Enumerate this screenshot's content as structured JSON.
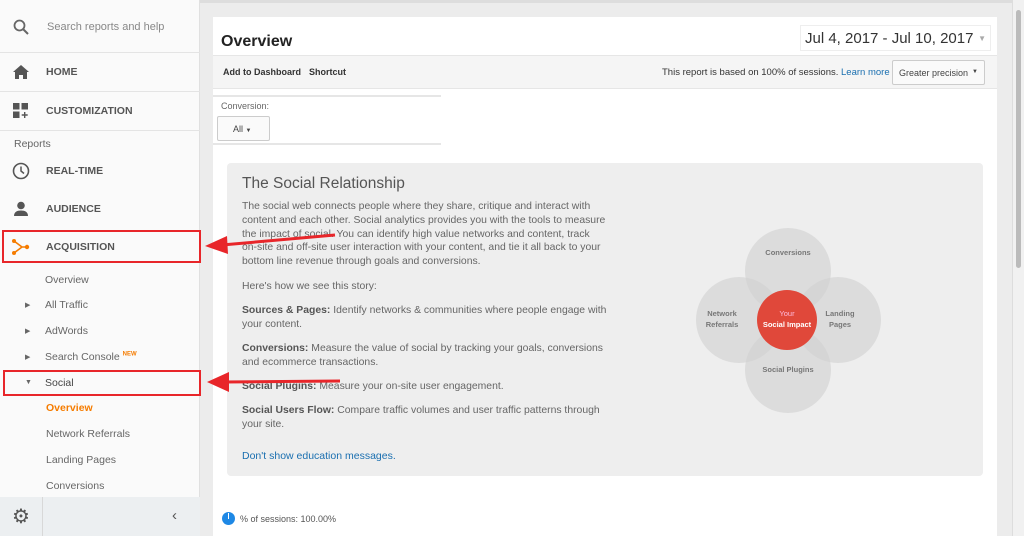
{
  "sidebar": {
    "search_placeholder": "Search reports and help",
    "home": "HOME",
    "customization": "CUSTOMIZATION",
    "reports_label": "Reports",
    "realtime": "REAL-TIME",
    "audience": "AUDIENCE",
    "acquisition": "ACQUISITION",
    "acq_items": {
      "overview": "Overview",
      "all_traffic": "All Traffic",
      "adwords": "AdWords",
      "search_console": "Search Console",
      "new_badge": "NEW",
      "social": "Social"
    },
    "social_items": [
      "Overview",
      "Network Referrals",
      "Landing Pages",
      "Conversions"
    ]
  },
  "header": {
    "title": "Overview",
    "date_range": "Jul 4, 2017 - Jul 10, 2017"
  },
  "toolbar": {
    "add_dashboard": "Add to Dashboard",
    "shortcut": "Shortcut",
    "sampling_text": "This report is based on 100% of sessions.",
    "learn_more": "Learn more",
    "precision": "Greater precision"
  },
  "conversion": {
    "label": "Conversion:",
    "value": "All"
  },
  "card": {
    "title": "The Social Relationship",
    "intro": "The social web connects people where they share, critique and interact with content and each other. Social analytics provides you with the tools to measure the impact of social. You can identify high value networks and content, track on-site and off-site user interaction with your content, and tie it all back to your bottom line revenue through goals and conversions.",
    "story": "Here's how we see this story:",
    "items": [
      {
        "term": "Sources & Pages:",
        "text": " Identify networks & communities where people engage with your content."
      },
      {
        "term": "Conversions:",
        "text": " Measure the value of social by tracking your goals, conversions and ecommerce transactions."
      },
      {
        "term": "Social Plugins:",
        "text": " Measure your on-site user engagement."
      },
      {
        "term": "Social Users Flow:",
        "text": " Compare traffic volumes and user traffic patterns through your site."
      }
    ],
    "dismiss": "Don't show education messages.",
    "diagram": {
      "top": "Conversions",
      "left1": "Network",
      "left2": "Referrals",
      "right1": "Landing",
      "right2": "Pages",
      "bottom": "Social Plugins",
      "center1": "Your",
      "center2": "Social Impact"
    }
  },
  "footer": {
    "sessions": "% of sessions: 100.00%"
  },
  "colors": {
    "accent": "#f57c00",
    "highlight": "#e8262a",
    "link": "#1a6fb0",
    "impact": "#e0483a",
    "pie": "#1e88e5"
  }
}
